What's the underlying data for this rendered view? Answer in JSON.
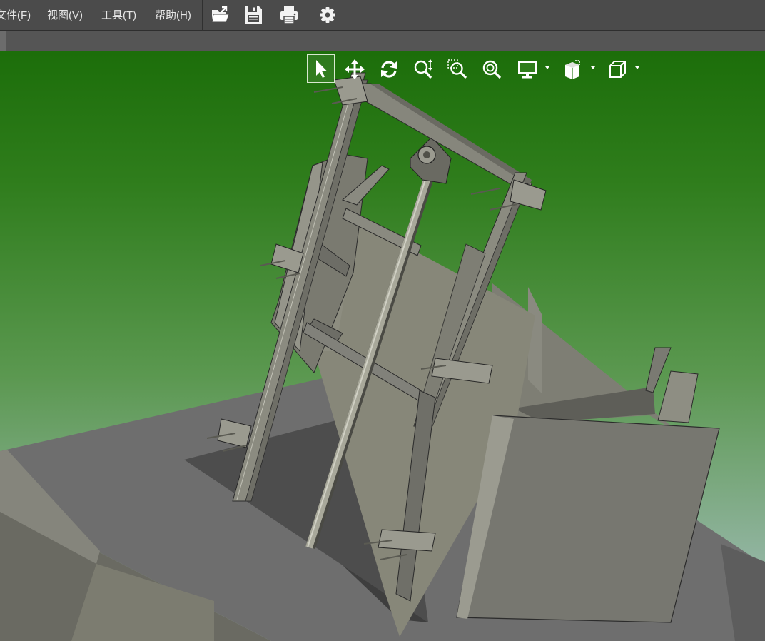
{
  "menubar": {
    "items": [
      {
        "label": "文件(F)"
      },
      {
        "label": "视图(V)"
      },
      {
        "label": "工具(T)"
      },
      {
        "label": "帮助(H)"
      }
    ],
    "toolbar_icons": [
      "open-file-icon",
      "save-icon",
      "print-icon",
      "settings-gear-icon"
    ]
  },
  "view_toolbar": {
    "icons": [
      "select-arrow-icon",
      "pan-move-icon",
      "rotate-icon",
      "zoom-fit-icon",
      "zoom-window-icon",
      "zoom-icon",
      "display-monitor-icon",
      "render-style-icon",
      "view-cube-icon"
    ],
    "active": "select-arrow-icon"
  },
  "colors": {
    "menubar_bg": "#4b4b4b",
    "viewport_top": "#1c6e0a",
    "viewport_bottom": "#a9c1b8",
    "model_gray": "#7a7a72",
    "model_dark": "#4f4f4f"
  }
}
